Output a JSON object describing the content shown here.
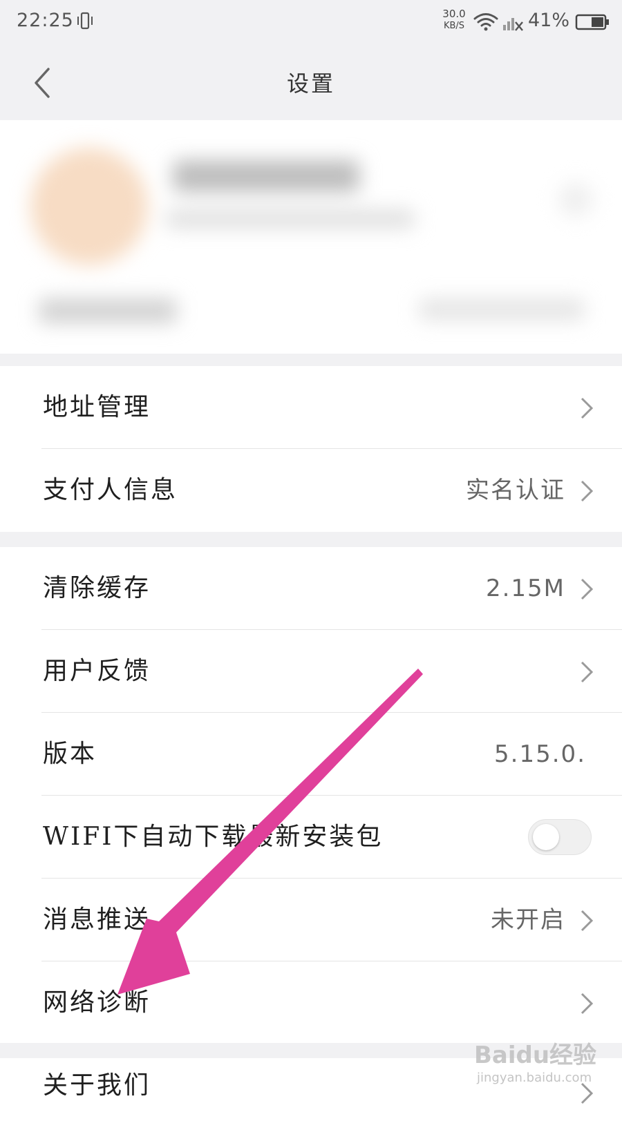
{
  "status_bar": {
    "time": "22:25",
    "net_speed_value": "30.0",
    "net_speed_unit": "KB/S",
    "battery_percent": "41%",
    "icons": [
      "vibrate-icon",
      "wifi-icon",
      "signal-off-icon",
      "battery-icon"
    ]
  },
  "header": {
    "title": "设置",
    "back_icon": "back-chevron-icon"
  },
  "groups": [
    {
      "items": [
        {
          "label": "地址管理",
          "value": "",
          "chevron": true
        },
        {
          "label": "支付人信息",
          "value": "实名认证",
          "chevron": true
        }
      ]
    },
    {
      "items": [
        {
          "label": "清除缓存",
          "value": "2.15M",
          "chevron": true
        },
        {
          "label": "用户反馈",
          "value": "",
          "chevron": true
        },
        {
          "label": "版本",
          "value": "5.15.0.",
          "chevron": false
        },
        {
          "label": "WIFI下自动下载最新安装包",
          "toggle": false
        },
        {
          "label": "消息推送",
          "value": "未开启",
          "chevron": true
        },
        {
          "label": "网络诊断",
          "value": "",
          "chevron": true
        }
      ]
    },
    {
      "items": [
        {
          "label": "关于我们",
          "value": "",
          "chevron": true
        }
      ]
    }
  ],
  "annotation": {
    "arrow_color": "#e0409a"
  },
  "watermark": {
    "logo": "Baidu经验",
    "url": "jingyan.baidu.com"
  },
  "colors": {
    "background": "#f1f1f3",
    "card": "#ffffff",
    "divider": "#e4e4e4",
    "text_primary": "#1f1f1f",
    "text_secondary": "#666666"
  }
}
